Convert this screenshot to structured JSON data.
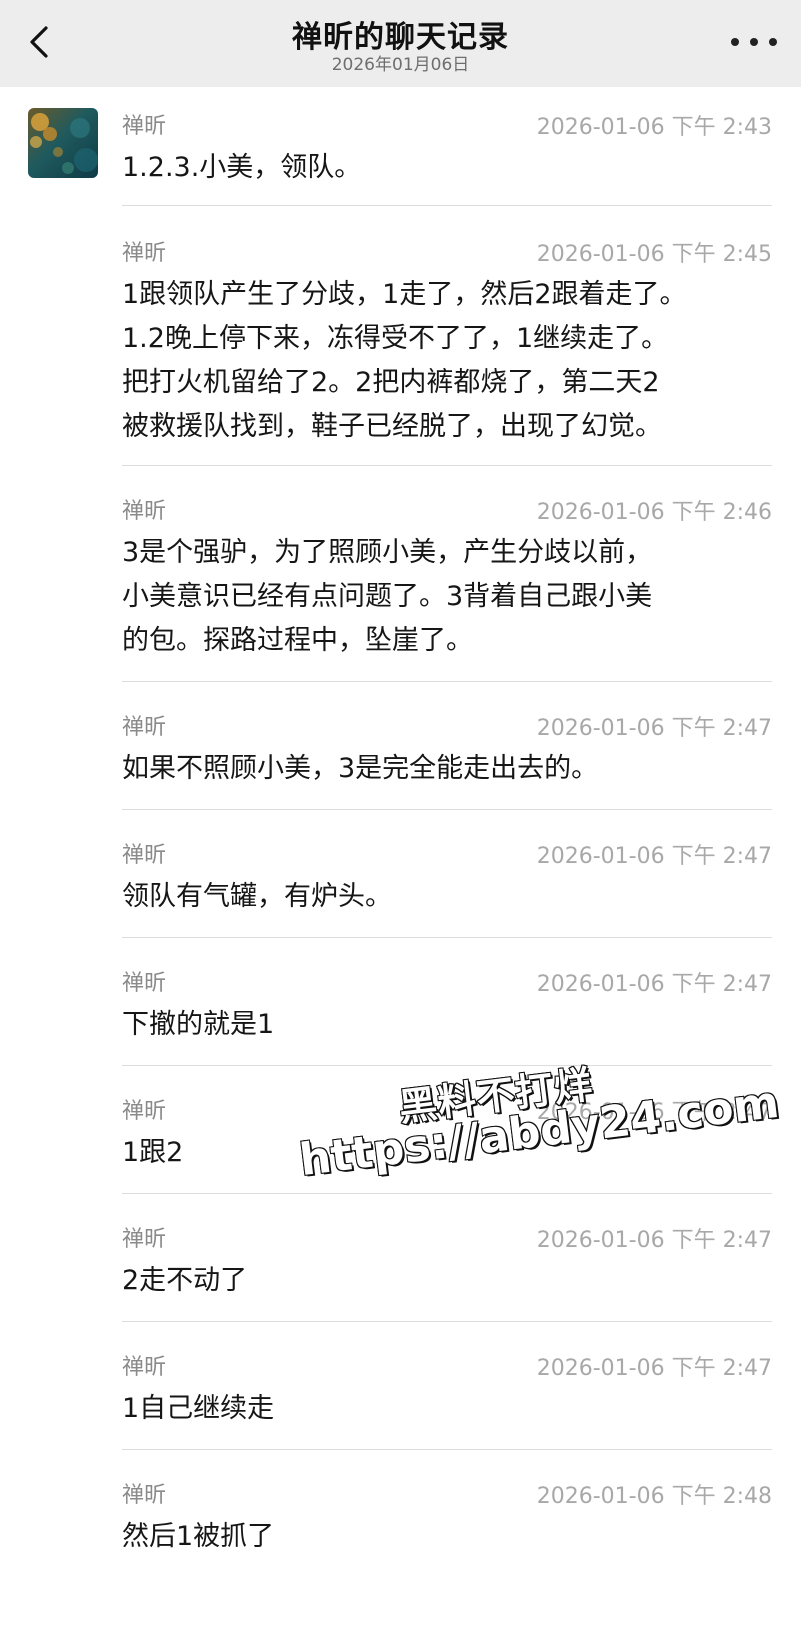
{
  "header": {
    "title": "禅昕的聊天记录",
    "subtitle": "2026年01月06日",
    "back_icon": "chevron-left-icon",
    "more_icon": "ellipsis-icon"
  },
  "messages": [
    {
      "sender": "禅昕",
      "time": "2026-01-06 下午 2:43",
      "text": "1.2.3.小美，领队。"
    },
    {
      "sender": "禅昕",
      "time": "2026-01-06 下午 2:45",
      "text": "1跟领队产生了分歧，1走了，然后2跟着走了。\n1.2晚上停下来，冻得受不了了，1继续走了。\n把打火机留给了2。2把内裤都烧了，第二天2\n被救援队找到，鞋子已经脱了，出现了幻觉。"
    },
    {
      "sender": "禅昕",
      "time": "2026-01-06 下午 2:46",
      "text": "3是个强驴，为了照顾小美，产生分歧以前，\n小美意识已经有点问题了。3背着自己跟小美\n的包。探路过程中，坠崖了。"
    },
    {
      "sender": "禅昕",
      "time": "2026-01-06 下午 2:47",
      "text": "如果不照顾小美，3是完全能走出去的。"
    },
    {
      "sender": "禅昕",
      "time": "2026-01-06 下午 2:47",
      "text": "领队有气罐，有炉头。"
    },
    {
      "sender": "禅昕",
      "time": "2026-01-06 下午 2:47",
      "text": "下撤的就是1"
    },
    {
      "sender": "禅昕",
      "time": "2026-01-06 下午 2:47",
      "text": "1跟2"
    },
    {
      "sender": "禅昕",
      "time": "2026-01-06 下午 2:47",
      "text": "2走不动了"
    },
    {
      "sender": "禅昕",
      "time": "2026-01-06 下午 2:47",
      "text": "1自己继续走"
    },
    {
      "sender": "禅昕",
      "time": "2026-01-06 下午 2:48",
      "text": "然后1被抓了"
    }
  ],
  "watermark": {
    "line1": "黑料不打烊",
    "line2": "https://abdy24.com"
  }
}
